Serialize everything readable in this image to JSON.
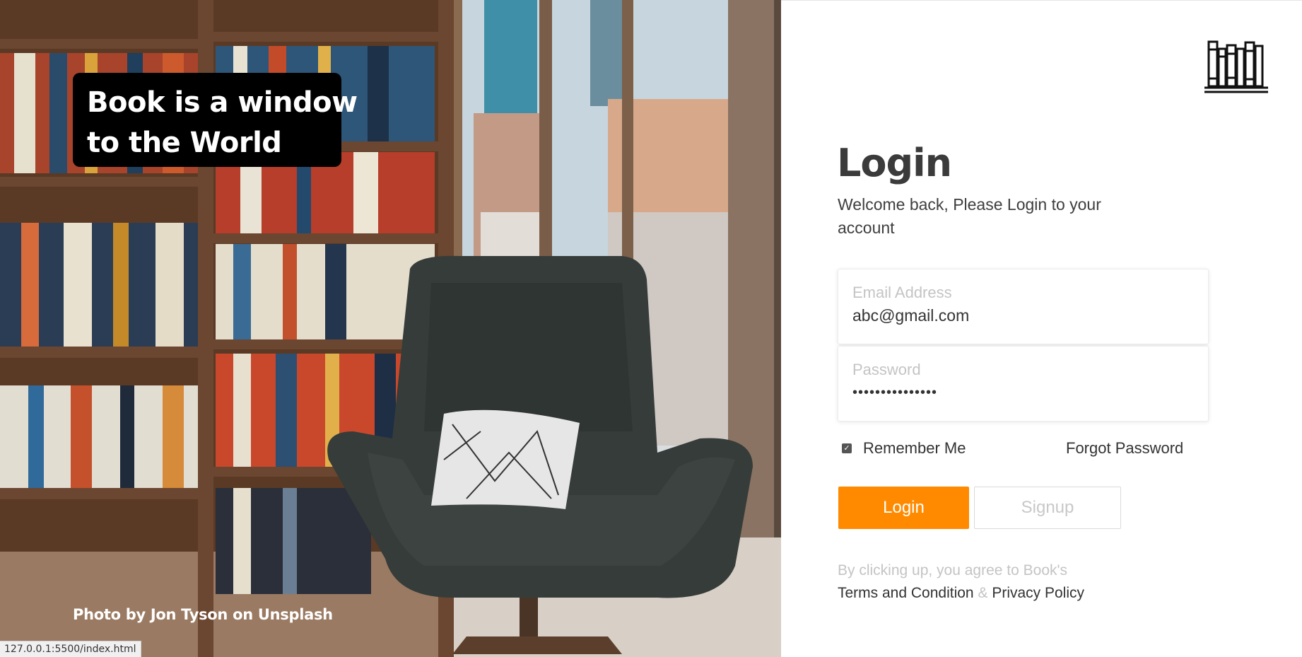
{
  "hero": {
    "tagline_line1": "Book is a window",
    "tagline_line2": "to the World",
    "photo_credit": "Photo by Jon Tyson on Unsplash"
  },
  "form": {
    "logo_icon": "bookshelf-icon",
    "title": "Login",
    "subtitle": "Welcome back, Please Login to your account",
    "email": {
      "label": "Email Address",
      "value": "abc@gmail.com"
    },
    "password": {
      "label": "Password",
      "value": "•••••••••••••••"
    },
    "remember_label": "Remember Me",
    "remember_checked": true,
    "forgot_label": "Forgot Password",
    "login_label": "Login",
    "signup_label": "Signup",
    "terms_prefix": "By clicking up, you agree to Book's",
    "terms_link": "Terms and Condition",
    "terms_amp": "&",
    "privacy_link": "Privacy Policy"
  },
  "colors": {
    "accent": "#ff8a00",
    "title": "#3b3b3b",
    "muted": "#c4c4c4"
  },
  "statusbar": {
    "url": "127.0.0.1:5500/index.html"
  }
}
